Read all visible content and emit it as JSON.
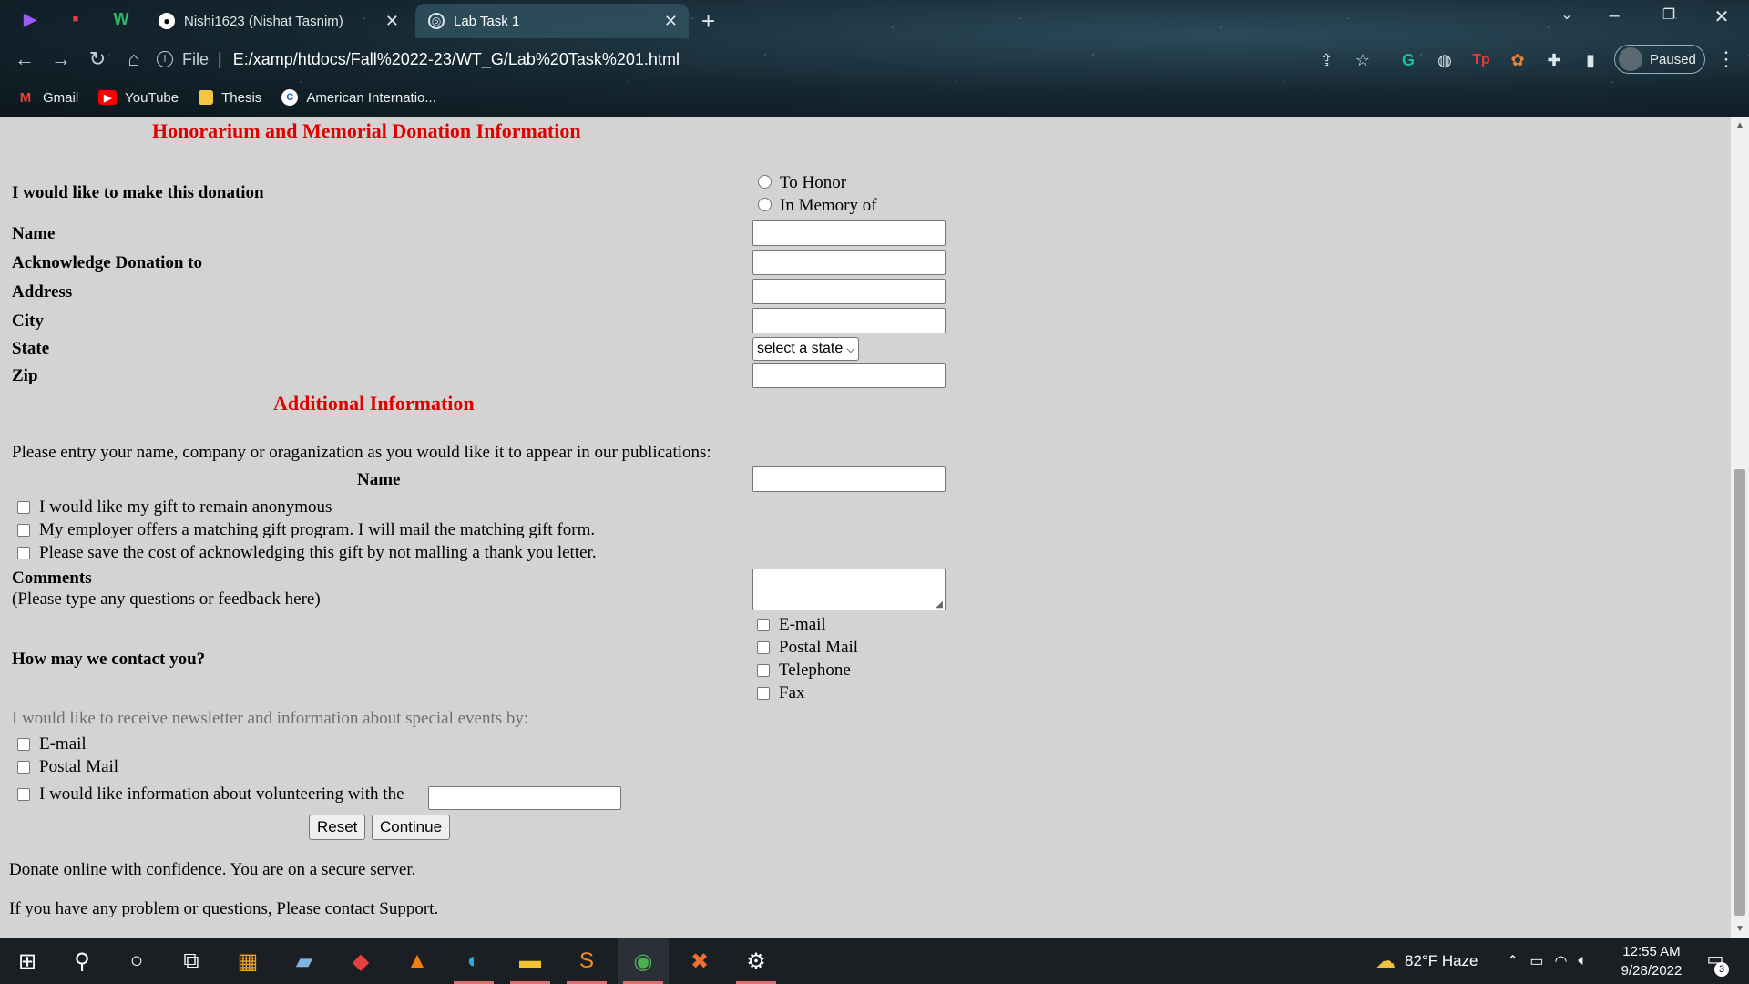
{
  "browser": {
    "tabs": [
      {
        "title": "Nishi1623 (Nishat Tasnim)",
        "active": false
      },
      {
        "title": "Lab Task 1",
        "active": true
      }
    ],
    "address": {
      "scheme": "File",
      "url": "E:/xamp/htdocs/Fall%2022-23/WT_G/Lab%20Task%201.html"
    },
    "profile_label": "Paused",
    "bookmarks": [
      {
        "label": "Gmail",
        "icon": "gmail-icon"
      },
      {
        "label": "YouTube",
        "icon": "youtube-icon"
      },
      {
        "label": "Thesis",
        "icon": "folder-icon"
      },
      {
        "label": "American Internatio...",
        "icon": "aiub-icon"
      }
    ]
  },
  "form": {
    "heading": "Honorarium and Memorial Donation Information",
    "donation_label": "I would like to make this donation",
    "donation_options": [
      "To Honor",
      "In Memory of"
    ],
    "fields": {
      "name": "Name",
      "acknowledge": "Acknowledge Donation to",
      "address": "Address",
      "city": "City",
      "state": "State",
      "zip": "Zip"
    },
    "state_select": "select a state",
    "additional_heading": "Additional Information",
    "publication_text": "Please entry your name, company or oraganization as you would like it to appear in our publications:",
    "pub_name_label": "Name",
    "checkboxes": [
      "I would like my gift to remain anonymous",
      "My employer offers a matching gift program. I will mail the matching gift form.",
      "Please save the cost of acknowledging this gift by not malling a thank you letter."
    ],
    "comments_label": "Comments",
    "comments_hint": "(Please type any questions or feedback here)",
    "contact_question": "How may we contact you?",
    "contact_options": [
      "E-mail",
      "Postal Mail",
      "Telephone",
      "Fax"
    ],
    "newsletter_text": "I would like to receive newsletter and information about special events by:",
    "newsletter_options": [
      "E-mail",
      "Postal Mail"
    ],
    "volunteer_text": "I would like information about volunteering with the",
    "reset_label": "Reset",
    "continue_label": "Continue",
    "footer_secure": "Donate online with confidence. You are on a secure server.",
    "footer_support": "If you have any problem or questions, Please contact Support."
  },
  "taskbar": {
    "weather": "82°F  Haze",
    "time": "12:55 AM",
    "date": "9/28/2022",
    "notifications": "3"
  },
  "colors": {
    "heading_red": "#e00000",
    "page_bg": "#d3d3d3"
  }
}
